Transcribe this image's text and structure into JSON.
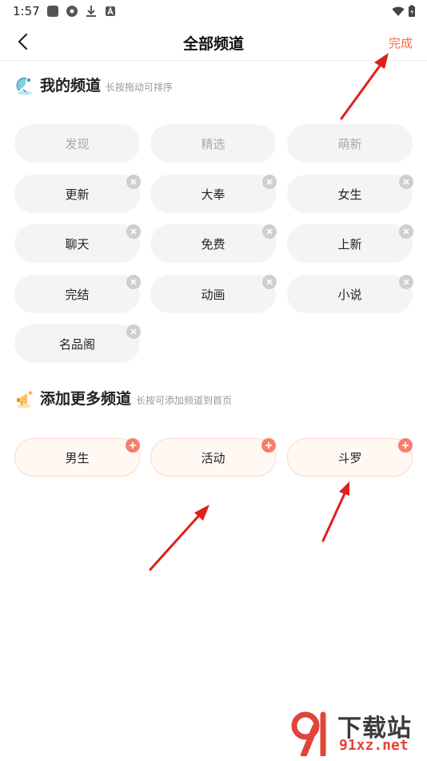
{
  "status_bar": {
    "time": "1:57"
  },
  "nav": {
    "title": "全部频道",
    "done_label": "完成"
  },
  "my_channels": {
    "title": "我的频道",
    "hint": "长按拖动可排序",
    "items": [
      {
        "label": "发现",
        "fixed": true
      },
      {
        "label": "精选",
        "fixed": true
      },
      {
        "label": "萌新",
        "fixed": true
      },
      {
        "label": "更新",
        "fixed": false
      },
      {
        "label": "大奉",
        "fixed": false
      },
      {
        "label": "女生",
        "fixed": false
      },
      {
        "label": "聊天",
        "fixed": false
      },
      {
        "label": "免费",
        "fixed": false
      },
      {
        "label": "上新",
        "fixed": false
      },
      {
        "label": "完结",
        "fixed": false
      },
      {
        "label": "动画",
        "fixed": false
      },
      {
        "label": "小说",
        "fixed": false
      },
      {
        "label": "名品阁",
        "fixed": false
      }
    ]
  },
  "more_channels": {
    "title": "添加更多频道",
    "hint": "长按可添加频道到首页",
    "items": [
      {
        "label": "男生"
      },
      {
        "label": "活动"
      },
      {
        "label": "斗罗"
      }
    ]
  },
  "watermark": {
    "text_cn": "下载站",
    "text_en": "91xz.net"
  },
  "colors": {
    "accent": "#ff6a3d",
    "chip_bg": "#f4f4f4",
    "add_chip_bg": "#fff8f3",
    "plus_badge": "#f5806b",
    "arrow": "#e0201b"
  }
}
